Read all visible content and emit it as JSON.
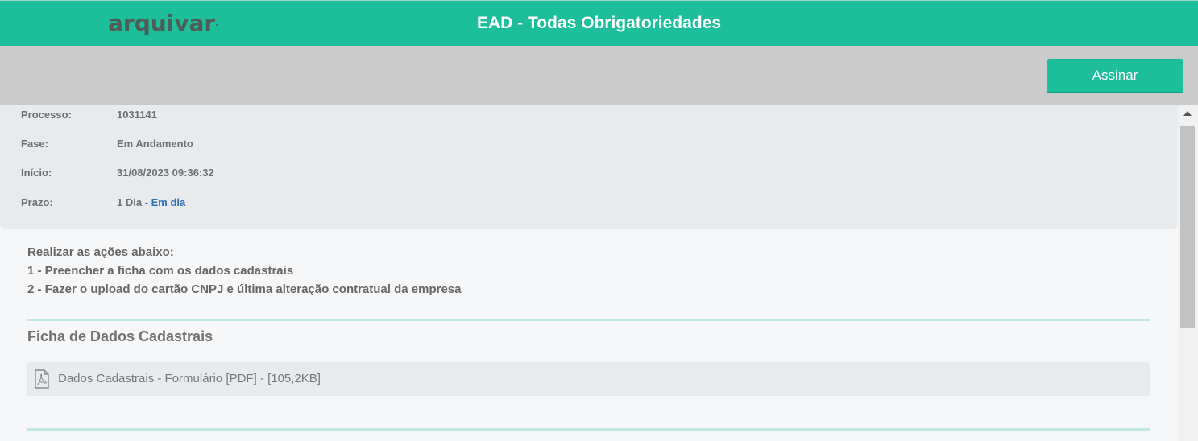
{
  "header": {
    "logo": "arquivar",
    "logo_mark": ".",
    "title": "EAD - Todas Obrigatoriedades"
  },
  "toolbar": {
    "sign_label": "Assinar"
  },
  "info": {
    "processo_label": "Processo:",
    "processo_value": "1031141",
    "fase_label": "Fase:",
    "fase_value": "Em Andamento",
    "inicio_label": "Início:",
    "inicio_value": "31/08/2023 09:36:32",
    "prazo_label": "Prazo:",
    "prazo_value": "1 Dia",
    "prazo_sep": " - ",
    "prazo_status": "Em dia"
  },
  "instructions": {
    "heading": "Realizar as ações abaixo:",
    "step1": "1 - Preencher a ficha com os dados cadastrais",
    "step2": "2 - Fazer o upload do cartão CNPJ e última alteração contratual da empresa"
  },
  "section": {
    "title": "Ficha de Dados Cadastrais",
    "file_label": "Dados Cadastrais - Formulário [PDF] - [105,2KB]",
    "file_icon": "pdf-file-icon"
  },
  "colors": {
    "accent": "#1dbe9c",
    "link": "#2d6fb7",
    "divider": "#bfe9df"
  }
}
